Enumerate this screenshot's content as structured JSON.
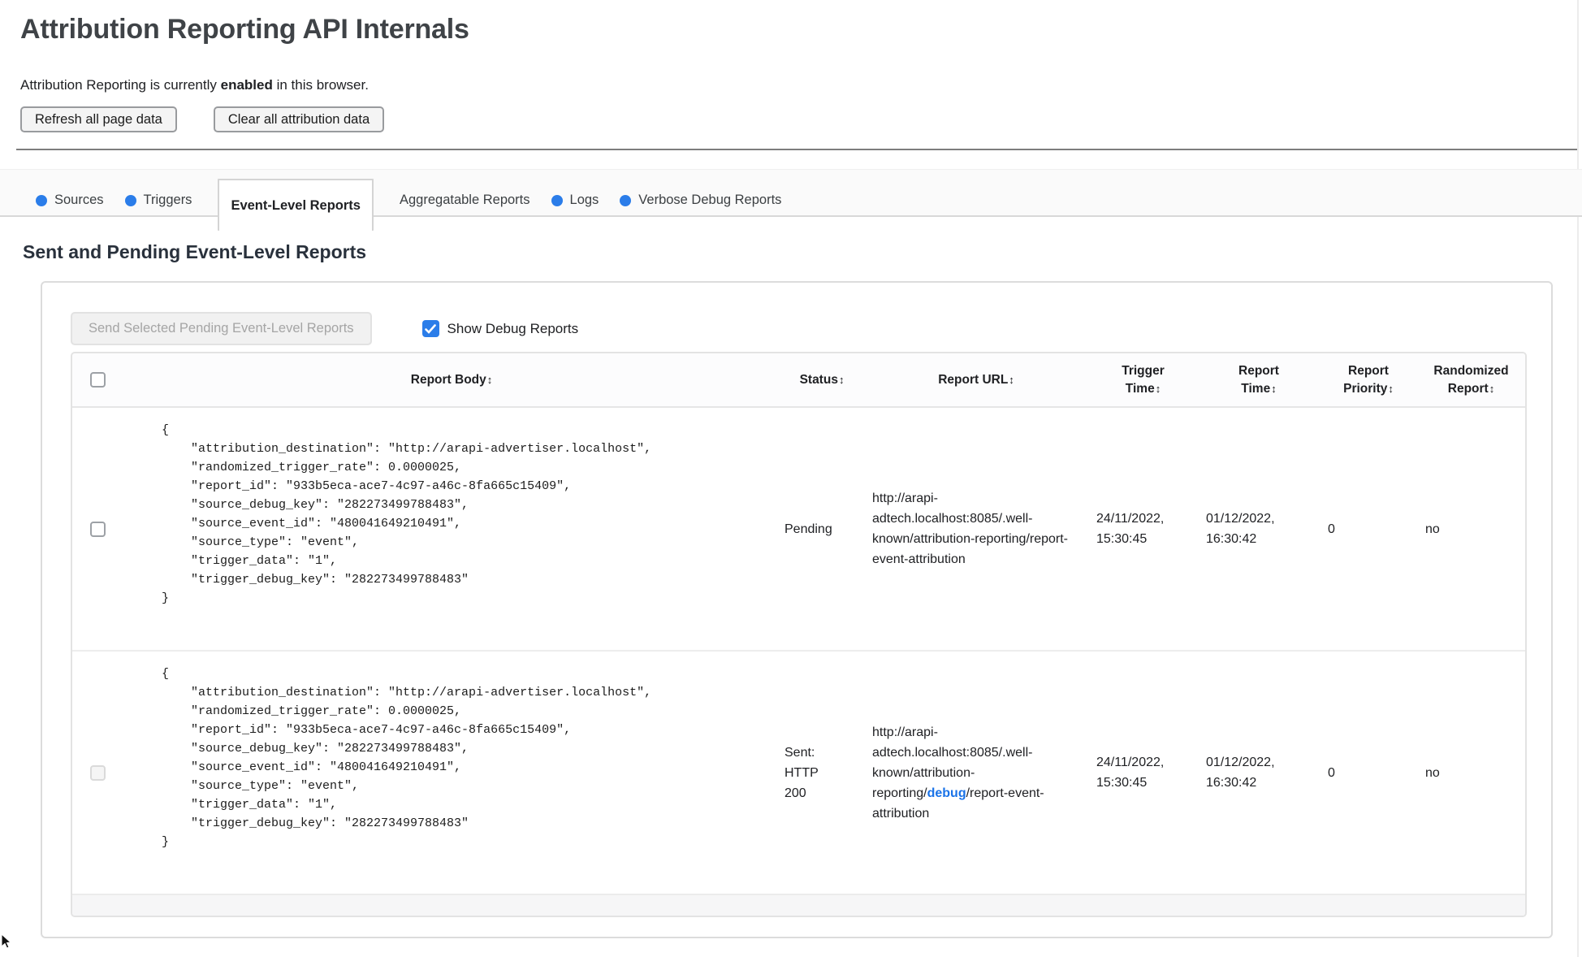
{
  "page": {
    "title": "Attribution Reporting API Internals"
  },
  "status_line": {
    "prefix": "Attribution Reporting is currently ",
    "highlight": "enabled",
    "suffix": " in this browser."
  },
  "toolbar": {
    "refresh_label": "Refresh all page data",
    "clear_label": "Clear all attribution data"
  },
  "tabs": [
    {
      "label": "Sources",
      "unread_dot": true,
      "active": false
    },
    {
      "label": "Triggers",
      "unread_dot": true,
      "active": false
    },
    {
      "label": "Event-Level Reports",
      "unread_dot": false,
      "active": true
    },
    {
      "label": "Aggregatable Reports",
      "unread_dot": false,
      "active": false
    },
    {
      "label": "Logs",
      "unread_dot": true,
      "active": false
    },
    {
      "label": "Verbose Debug Reports",
      "unread_dot": true,
      "active": false
    }
  ],
  "section": {
    "heading": "Sent and Pending Event-Level Reports",
    "send_button_label": "Send Selected Pending Event-Level Reports",
    "show_debug_label": "Show Debug Reports"
  },
  "colors": {
    "accent_blue": "#2b7de9",
    "link_blue": "#1a73e8"
  },
  "table": {
    "sort_icon": "↕",
    "columns": [
      "Report Body",
      "Status",
      "Report URL",
      "Trigger Time",
      "Report Time",
      "Report Priority",
      "Randomized Report"
    ],
    "rows": [
      {
        "report_body": "{\n    \"attribution_destination\": \"http://arapi-advertiser.localhost\",\n    \"randomized_trigger_rate\": 0.0000025,\n    \"report_id\": \"933b5eca-ace7-4c97-a46c-8fa665c15409\",\n    \"source_debug_key\": \"282273499788483\",\n    \"source_event_id\": \"480041649210491\",\n    \"source_type\": \"event\",\n    \"trigger_data\": \"1\",\n    \"trigger_debug_key\": \"282273499788483\"\n}",
        "status": "Pending",
        "url_prefix": "http://arapi-adtech.localhost:8085/.well-known/attribution-reporting/report-event-attribution",
        "url_debug": "",
        "url_suffix": "",
        "trigger_time": "24/11/2022, 15:30:45",
        "report_time": "01/12/2022, 16:30:42",
        "priority": "0",
        "randomized": "no"
      },
      {
        "report_body": "{\n    \"attribution_destination\": \"http://arapi-advertiser.localhost\",\n    \"randomized_trigger_rate\": 0.0000025,\n    \"report_id\": \"933b5eca-ace7-4c97-a46c-8fa665c15409\",\n    \"source_debug_key\": \"282273499788483\",\n    \"source_event_id\": \"480041649210491\",\n    \"source_type\": \"event\",\n    \"trigger_data\": \"1\",\n    \"trigger_debug_key\": \"282273499788483\"\n}",
        "status": "Sent: HTTP 200",
        "url_prefix": "http://arapi-adtech.localhost:8085/.well-known/attribution-reporting/",
        "url_debug": "debug",
        "url_suffix": "/report-event-attribution",
        "trigger_time": "24/11/2022, 15:30:45",
        "report_time": "01/12/2022, 16:30:42",
        "priority": "0",
        "randomized": "no"
      }
    ]
  }
}
